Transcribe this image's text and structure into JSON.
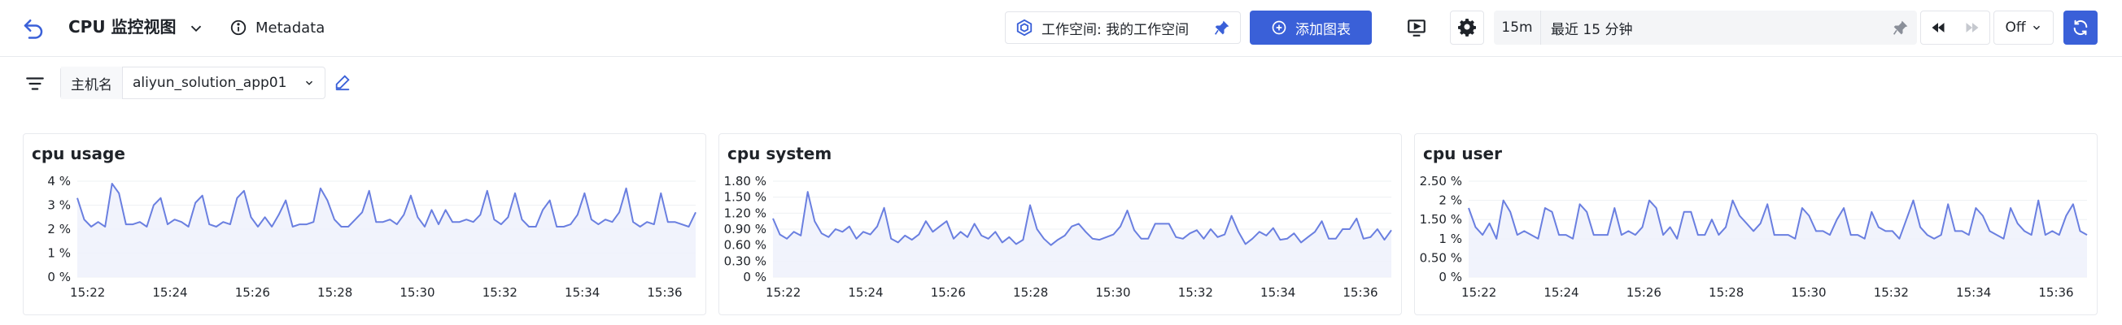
{
  "header": {
    "title": "CPU 监控视图",
    "metadata_label": "Metadata",
    "workspace_label": "工作空间: 我的工作空间",
    "add_chart_label": "添加图表",
    "time_short": "15m",
    "time_range_label": "最近 15 分钟",
    "refresh_mode": "Off"
  },
  "filter": {
    "variable_label": "主机名",
    "variable_value": "aliyun_solution_app01"
  },
  "colors": {
    "accent": "#3a60d8",
    "line": "#6a7fe0",
    "area": "#eef1fc"
  },
  "chart_data": [
    {
      "type": "area",
      "title": "cpu usage",
      "x_ticks": [
        "15:22",
        "15:24",
        "15:26",
        "15:28",
        "15:30",
        "15:32",
        "15:34",
        "15:36"
      ],
      "y_ticks": [
        "0 %",
        "1 %",
        "2 %",
        "3 %",
        "4 %"
      ],
      "ylim": [
        0,
        4
      ],
      "x_start": "15:21:45",
      "x_end": "15:36:45",
      "values": [
        3.3,
        2.4,
        2.1,
        2.3,
        2.1,
        3.9,
        3.5,
        2.2,
        2.2,
        2.3,
        2.1,
        3.0,
        3.3,
        2.2,
        2.4,
        2.3,
        2.1,
        3.1,
        3.4,
        2.2,
        2.1,
        2.3,
        2.2,
        3.3,
        3.6,
        2.5,
        2.1,
        2.5,
        2.1,
        2.6,
        3.2,
        2.1,
        2.2,
        2.2,
        2.3,
        3.7,
        3.2,
        2.4,
        2.1,
        2.1,
        2.4,
        2.7,
        3.6,
        2.3,
        2.3,
        2.4,
        2.2,
        2.6,
        3.4,
        2.5,
        2.1,
        2.8,
        2.2,
        2.8,
        2.3,
        2.3,
        2.4,
        2.3,
        2.6,
        3.6,
        2.4,
        2.2,
        2.5,
        3.5,
        2.4,
        2.1,
        2.1,
        2.8,
        3.2,
        2.1,
        2.1,
        2.2,
        2.6,
        3.5,
        2.4,
        2.2,
        2.4,
        2.3,
        2.7,
        3.7,
        2.3,
        2.1,
        2.3,
        2.2,
        3.5,
        2.3,
        2.3,
        2.2,
        2.1,
        2.7
      ]
    },
    {
      "type": "area",
      "title": "cpu system",
      "x_ticks": [
        "15:22",
        "15:24",
        "15:26",
        "15:28",
        "15:30",
        "15:32",
        "15:34",
        "15:36"
      ],
      "y_ticks": [
        "0 %",
        "0.30 %",
        "0.60 %",
        "0.90 %",
        "1.20 %",
        "1.50 %",
        "1.80 %"
      ],
      "ylim": [
        0,
        1.8
      ],
      "x_start": "15:21:45",
      "x_end": "15:36:45",
      "values": [
        1.1,
        0.8,
        0.72,
        0.85,
        0.78,
        1.6,
        1.05,
        0.82,
        0.75,
        0.9,
        0.85,
        0.95,
        0.72,
        0.85,
        0.8,
        0.95,
        1.3,
        0.72,
        0.65,
        0.78,
        0.7,
        0.8,
        1.05,
        0.85,
        0.95,
        1.05,
        0.72,
        0.85,
        0.75,
        1.0,
        0.78,
        0.72,
        0.85,
        0.65,
        0.75,
        0.62,
        0.7,
        1.35,
        0.9,
        0.72,
        0.6,
        0.7,
        0.78,
        0.95,
        1.0,
        0.85,
        0.72,
        0.7,
        0.75,
        0.8,
        0.95,
        1.25,
        0.88,
        0.72,
        0.72,
        1.0,
        1.0,
        1.0,
        0.75,
        0.72,
        0.82,
        0.88,
        0.72,
        0.9,
        0.75,
        0.8,
        1.15,
        0.85,
        0.62,
        0.72,
        0.85,
        0.78,
        0.92,
        0.7,
        0.72,
        0.82,
        0.65,
        0.75,
        0.85,
        1.05,
        0.72,
        0.72,
        0.9,
        0.9,
        1.1,
        0.72,
        0.75,
        0.9,
        0.7,
        0.88
      ]
    },
    {
      "type": "area",
      "title": "cpu user",
      "x_ticks": [
        "15:22",
        "15:24",
        "15:26",
        "15:28",
        "15:30",
        "15:32",
        "15:34",
        "15:36"
      ],
      "y_ticks": [
        "0 %",
        "0.50 %",
        "1 %",
        "1.50 %",
        "2 %",
        "2.50 %"
      ],
      "ylim": [
        0,
        2.5
      ],
      "x_start": "15:21:45",
      "x_end": "15:36:45",
      "values": [
        1.8,
        1.3,
        1.1,
        1.4,
        1.0,
        2.0,
        1.7,
        1.1,
        1.2,
        1.1,
        1.0,
        1.8,
        1.7,
        1.1,
        1.1,
        1.0,
        1.9,
        1.7,
        1.1,
        1.1,
        1.1,
        1.8,
        1.1,
        1.2,
        1.1,
        1.3,
        2.0,
        1.8,
        1.1,
        1.3,
        1.0,
        1.7,
        1.7,
        1.1,
        1.1,
        1.5,
        1.1,
        1.3,
        2.0,
        1.6,
        1.4,
        1.2,
        1.4,
        1.9,
        1.1,
        1.1,
        1.1,
        1.0,
        1.8,
        1.6,
        1.2,
        1.2,
        1.1,
        1.5,
        1.8,
        1.1,
        1.1,
        1.0,
        1.7,
        1.3,
        1.2,
        1.2,
        1.0,
        1.5,
        2.0,
        1.3,
        1.1,
        1.0,
        1.1,
        1.9,
        1.2,
        1.2,
        1.1,
        1.8,
        1.6,
        1.2,
        1.1,
        1.0,
        1.8,
        1.4,
        1.2,
        1.1,
        2.0,
        1.1,
        1.2,
        1.1,
        1.6,
        1.9,
        1.2,
        1.1
      ]
    }
  ]
}
